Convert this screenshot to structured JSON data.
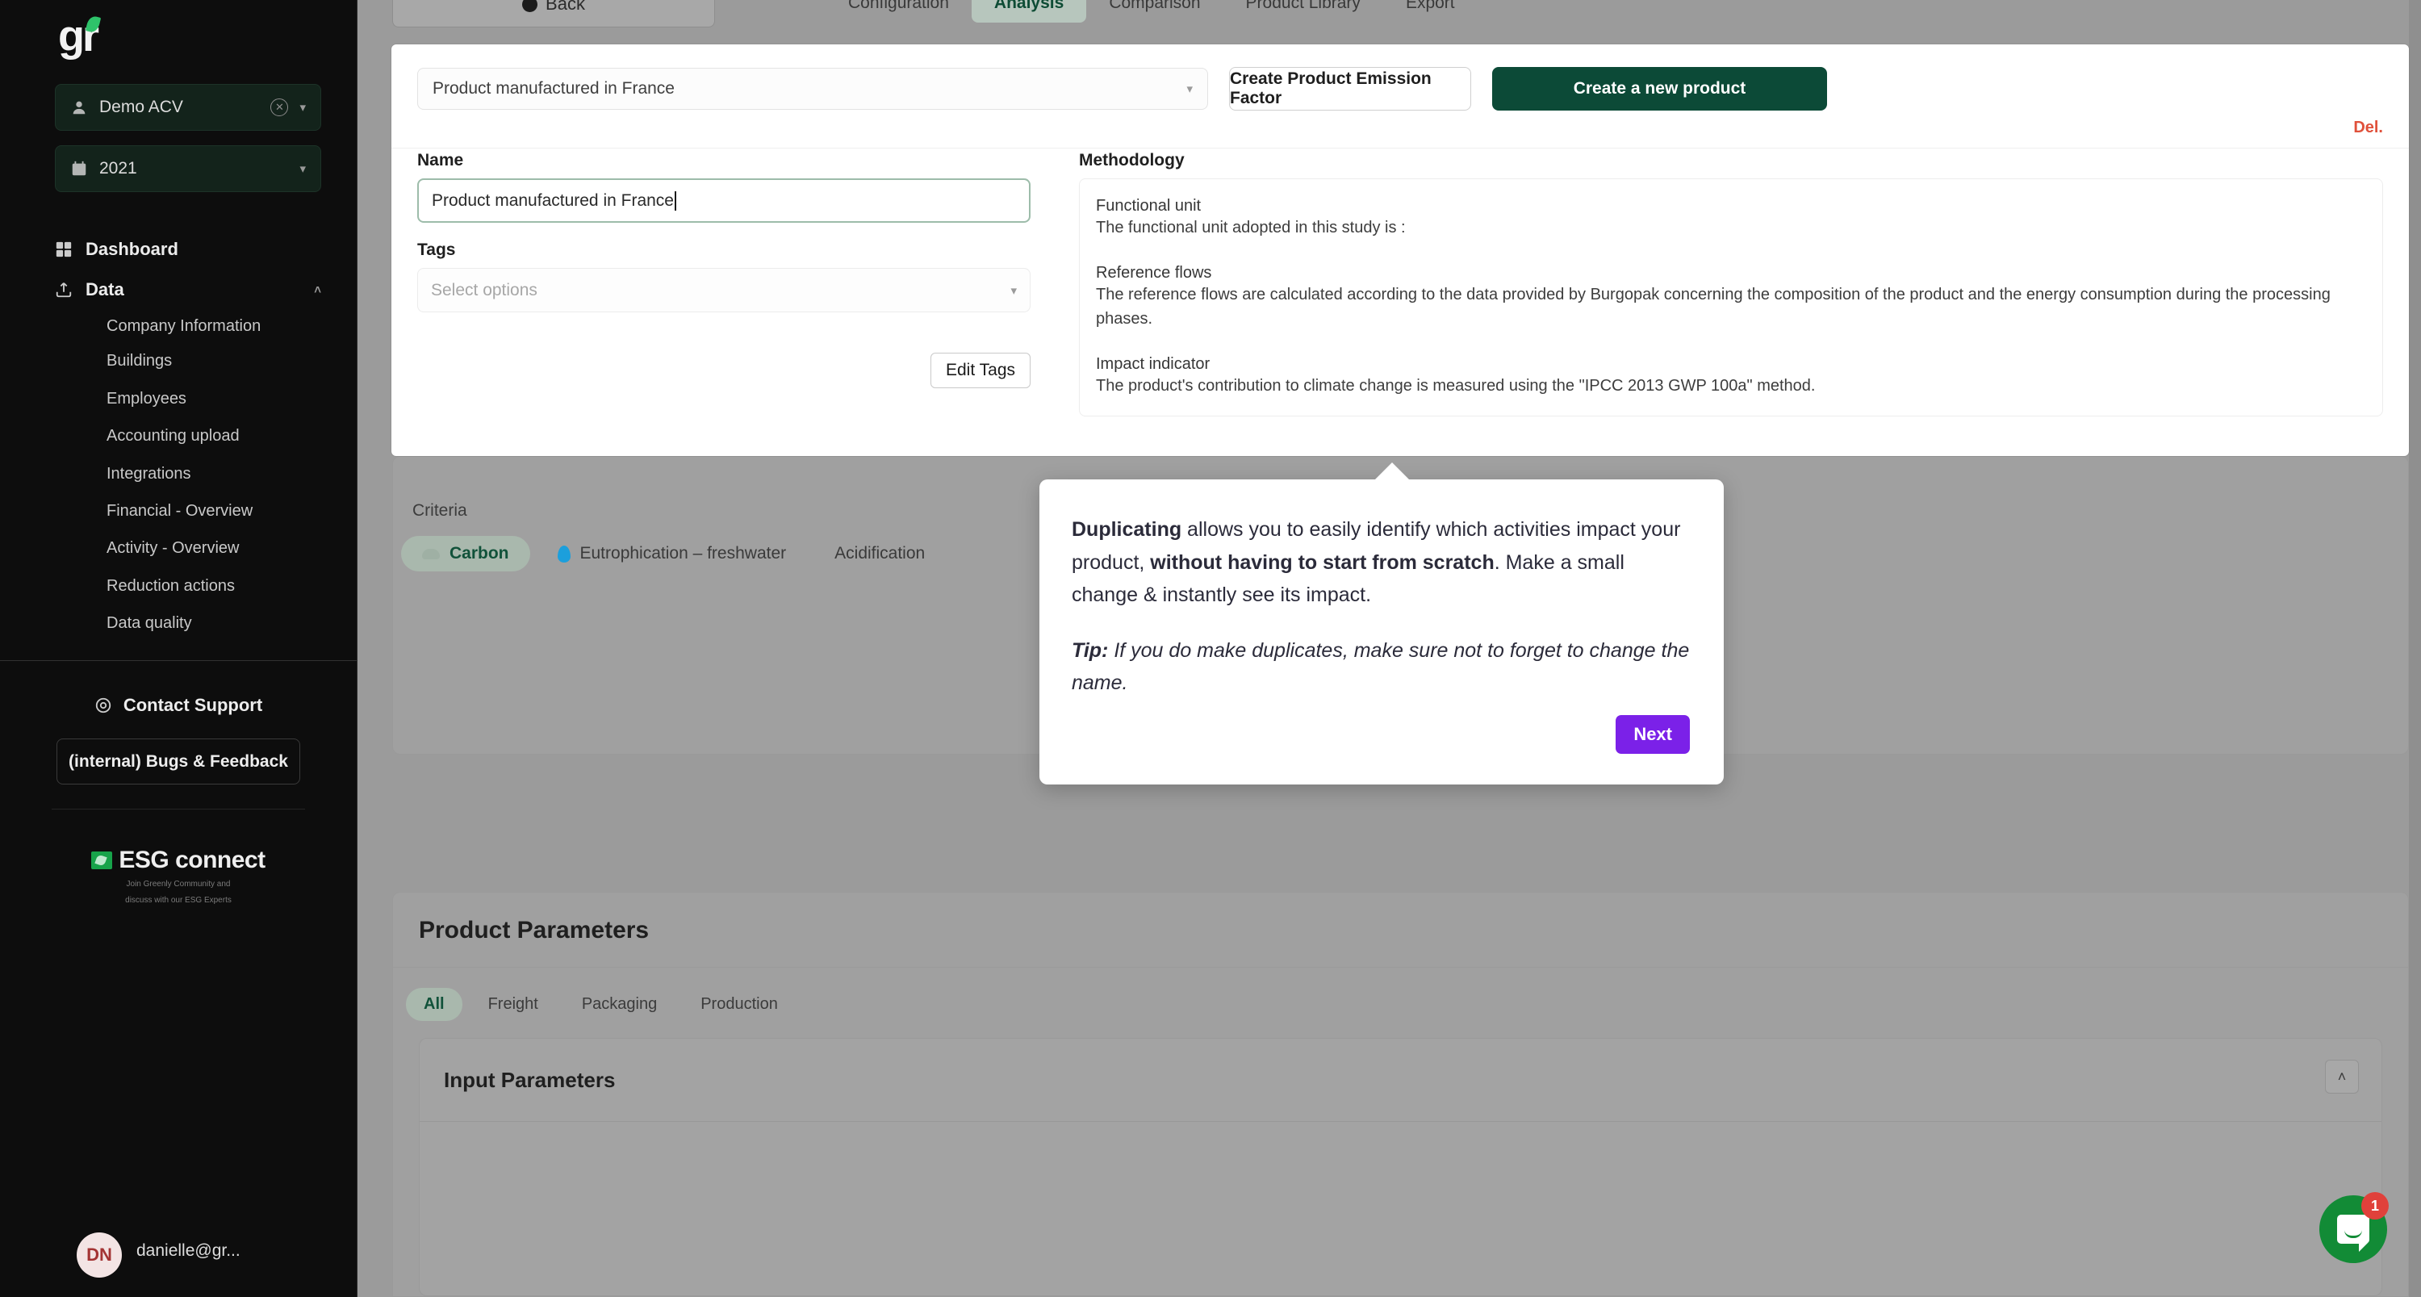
{
  "sidebar": {
    "logo_text": "gr",
    "org_selector": {
      "label": "Demo ACV",
      "icon": "user-icon"
    },
    "year_selector": {
      "label": "2021",
      "icon": "calendar-icon"
    },
    "nav": [
      {
        "label": "Dashboard",
        "icon": "grid-icon"
      },
      {
        "label": "Data",
        "icon": "upload-icon",
        "expanded": true
      }
    ],
    "data_children": [
      "Company Information",
      "Buildings",
      "Employees",
      "Accounting upload",
      "Integrations",
      "Financial - Overview",
      "Activity - Overview",
      "Reduction actions",
      "Data quality"
    ],
    "support_label": "Contact Support",
    "feedback_label": "(internal) Bugs & Feedback",
    "esg": {
      "name": "ESG connect",
      "tagline_line1": "Join Greenly Community and",
      "tagline_line2": "discuss with our ESG Experts"
    },
    "user": {
      "initials": "DN",
      "email": "danielle@gr..."
    }
  },
  "topbar": {
    "back_label": "Back",
    "tabs": [
      {
        "label": "Configuration",
        "active": false
      },
      {
        "label": "Analysis",
        "active": true
      },
      {
        "label": "Comparison",
        "active": false
      },
      {
        "label": "Product Library",
        "active": false
      },
      {
        "label": "Export",
        "active": false
      }
    ]
  },
  "product_panel": {
    "product_select_value": "Product manufactured in France",
    "create_pef_label": "Create Product Emission Factor",
    "create_product_label": "Create a new product",
    "delete_label": "Del.",
    "name_field": {
      "label": "Name",
      "value": "Product manufactured in France"
    },
    "tags_field": {
      "label": "Tags",
      "placeholder": "Select options"
    },
    "edit_tags_label": "Edit Tags",
    "methodology": {
      "label": "Methodology",
      "sections": [
        {
          "heading": "Functional unit",
          "body": "The functional unit adopted in this study is :"
        },
        {
          "heading": "Reference flows",
          "body": "The reference flows are calculated according to the data provided by Burgopak concerning the composition of the product and the energy consumption during the processing phases."
        },
        {
          "heading": "Impact indicator",
          "body": "The product's contribution to climate change is measured using the \"IPCC 2013 GWP 100a\" method."
        }
      ]
    }
  },
  "criteria": {
    "label": "Criteria",
    "items": [
      {
        "label": "Carbon",
        "icon": "cloud-icon",
        "active": true
      },
      {
        "label": "Eutrophication – freshwater",
        "icon": "water-drop-icon",
        "active": false
      },
      {
        "label": "Acidification",
        "icon": "",
        "active": false
      }
    ]
  },
  "product_parameters": {
    "title": "Product Parameters",
    "tabs": [
      {
        "label": "All",
        "active": true
      },
      {
        "label": "Freight",
        "active": false
      },
      {
        "label": "Packaging",
        "active": false
      },
      {
        "label": "Production",
        "active": false
      }
    ],
    "input_parameters_title": "Input Parameters",
    "collapse_icon": "chevron-up-icon"
  },
  "tour": {
    "p1_prefix_bold": "Duplicating",
    "p1_mid": " allows you to easily identify which activities impact your product, ",
    "p1_bold2": "without having to start from scratch",
    "p1_suffix": ". Make a small change & instantly see its impact.",
    "tip_label": "Tip:",
    "tip_text": " If you do make duplicates, make sure not to forget to change the name.",
    "next_label": "Next"
  },
  "intercom": {
    "badge_count": "1",
    "icon": "chat-bubble-icon"
  },
  "colors": {
    "brand_dark_green": "#0c4a37",
    "accent_purple": "#7b21e8",
    "danger_red": "#e0513b",
    "intercom_green": "#128b36",
    "overlay_gray": "#9b9b9b"
  }
}
